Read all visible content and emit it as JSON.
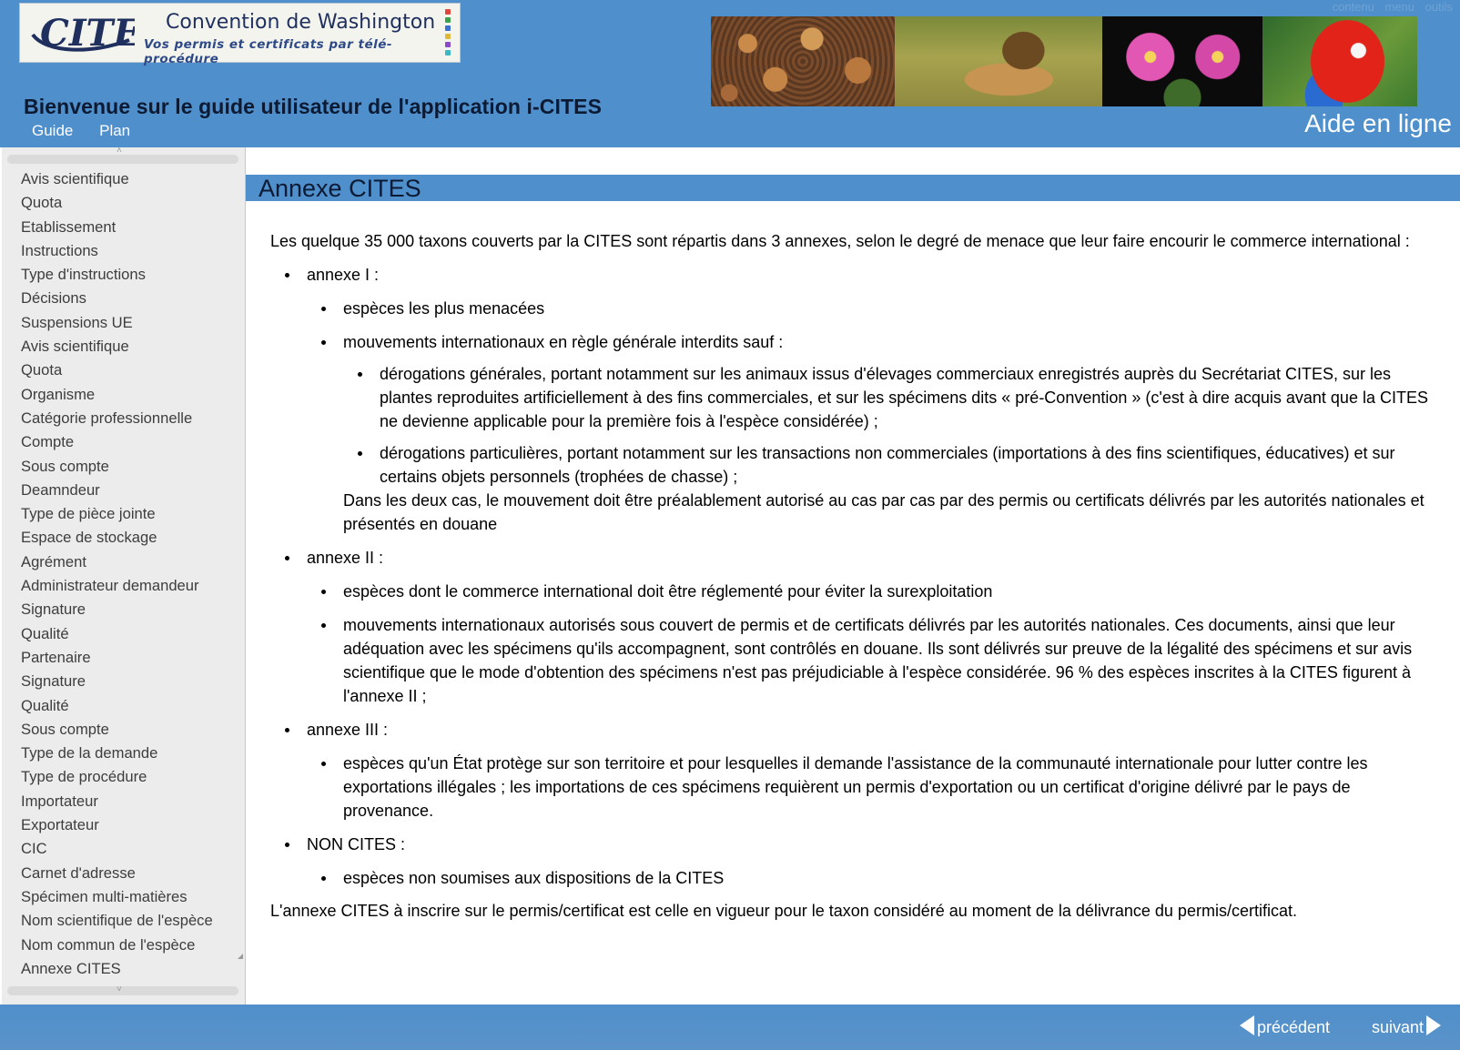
{
  "header": {
    "logo": {
      "mark_text": "CITES",
      "title": "Convention de Washington",
      "subtitle": "Vos permis et certificats par télé-procédure",
      "dot_colors": [
        "#e0463a",
        "#3aa24a",
        "#3a6fd1",
        "#e0b83a",
        "#8a4ac8",
        "#3ab8c8"
      ]
    },
    "top_links": [
      "contenu",
      "menu",
      "outils"
    ],
    "page_heading": "Bienvenue sur le guide utilisateur de l'application i-CITES",
    "nav": [
      "Guide",
      "Plan"
    ],
    "help_title": "Aide en ligne",
    "banner_images": [
      "tortoises-photo",
      "lion-photo",
      "cactus-flowers-photo",
      "parrot-photo"
    ]
  },
  "sidebar": {
    "items": [
      "Avis scientifique",
      "Quota",
      "Etablissement",
      "Instructions",
      "Type d'instructions",
      "Décisions",
      "Suspensions UE",
      "Avis scientifique",
      "Quota",
      "Organisme",
      "Catégorie professionnelle",
      "Compte",
      "Sous compte",
      "Deamndeur",
      "Type de pièce jointe",
      "Espace de stockage",
      "Agrément",
      "Administrateur demandeur",
      "Signature",
      "Qualité",
      "Partenaire",
      "Signature",
      "Qualité",
      "Sous compte",
      "Type de la demande",
      "Type de procédure",
      "Importateur",
      "Exportateur",
      "CIC",
      "Carnet d'adresse",
      "Spécimen multi-matières",
      "Nom scientifique de l'espèce",
      "Nom commun de l'espèce",
      "Annexe CITES"
    ],
    "scroll_up_icon": "chevron-up-icon",
    "scroll_down_icon": "chevron-down-icon"
  },
  "main": {
    "title": "Annexe CITES",
    "intro": "Les quelque 35 000 taxons couverts par la CITES sont répartis dans 3 annexes, selon le degré de menace que leur faire encourir le commerce international :",
    "annexe1": {
      "label": "annexe I :",
      "items": [
        "espèces les plus menacées",
        "mouvements internationaux en règle générale interdits sauf :"
      ],
      "sub_items": [
        "dérogations générales, portant notamment sur les animaux issus d'élevages commerciaux enregistrés auprès du Secrétariat CITES, sur les plantes reproduites artificiellement à des fins commerciales, et sur les spécimens dits « pré-Convention » (c'est à dire acquis avant que la CITES ne devienne applicable pour la première fois à l'espèce considérée) ;",
        "dérogations particulières, portant notamment sur les transactions non commerciales (importations à des fins scientifiques, éducatives) et sur certains objets personnels (trophées de chasse) ;"
      ],
      "note": "Dans les deux cas, le mouvement doit être préalablement autorisé au cas par cas par des permis ou certificats délivrés par les autorités nationales et présentés en douane"
    },
    "annexe2": {
      "label": "annexe II :",
      "items": [
        "espèces dont le commerce international doit être réglementé pour éviter la surexploitation",
        "mouvements internationaux autorisés sous couvert de permis et de certificats délivrés par les autorités nationales. Ces documents, ainsi que leur adéquation avec les spécimens qu'ils accompagnent, sont contrôlés en douane. Ils sont délivrés sur preuve de la légalité des spécimens et sur avis scientifique que le mode d'obtention des spécimens n'est pas préjudiciable à l'espèce considérée. 96 % des espèces inscrites à la CITES figurent à l'annexe II ;"
      ]
    },
    "annexe3": {
      "label": "annexe III :",
      "items": [
        "espèces qu'un État protège sur son territoire et pour lesquelles il demande l'assistance de la communauté internationale pour lutter contre les exportations illégales ; les importations de ces spécimens requièrent un permis d'exportation ou un certificat d'origine délivré par le pays de provenance."
      ]
    },
    "non_cites": {
      "label": "NON CITES :",
      "items": [
        "espèces non soumises aux dispositions de la CITES"
      ]
    },
    "conclusion": "L'annexe CITES à inscrire sur le permis/certificat est celle en vigueur pour le taxon considéré au moment de la délivrance du permis/certificat."
  },
  "footer": {
    "prev_label": "précédent",
    "next_label": "suivant"
  },
  "colors": {
    "header_blue": "#4f8fcb",
    "sidebar_bg": "#ececec",
    "heading_text": "#0c1a33"
  }
}
